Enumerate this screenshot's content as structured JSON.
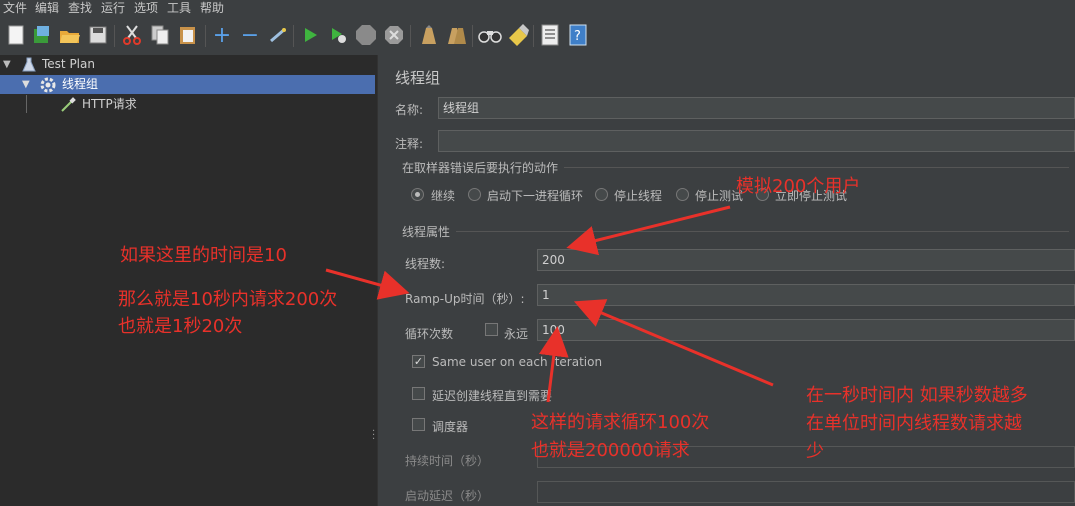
{
  "menu": [
    "文件",
    "编辑",
    "查找",
    "运行",
    "选项",
    "工具",
    "帮助"
  ],
  "tree": {
    "plan_label": "Test Plan",
    "group_label": "线程组",
    "sampler_label": "HTTP请求"
  },
  "panel": {
    "title": "线程组",
    "name_label": "名称:",
    "name_value": "线程组",
    "comment_label": "注释:",
    "comment_value": "",
    "error_action_title": "在取样器错误后要执行的动作",
    "error_actions": [
      "继续",
      "启动下一进程循环",
      "停止线程",
      "停止测试",
      "立即停止测试"
    ],
    "error_action_selected": "继续",
    "thread_props_title": "线程属性",
    "threads_label": "线程数:",
    "threads_value": "200",
    "rampup_label": "Ramp-Up时间（秒）:",
    "rampup_value": "1",
    "loop_label": "循环次数",
    "forever_label": "永远",
    "forever_checked": false,
    "loop_value": "100",
    "same_user_label": "Same user on each iteration",
    "same_user_checked": true,
    "delay_label": "延迟创建线程直到需要",
    "delay_checked": false,
    "scheduler_label": "调度器",
    "scheduler_checked": false,
    "duration_label": "持续时间（秒）",
    "startup_delay_label": "启动延迟（秒）"
  },
  "annotations": {
    "simulate_users": "模拟200个用户",
    "if_time_is": "如果这里的时间是10",
    "then_requests": "那么就是10秒内请求200次",
    "per_second": "也就是1秒20次",
    "loop_requests": "这样的请求循环100次",
    "total_requests": "也就是200000请求",
    "within_second": "在一秒时间内  如果秒数越多",
    "unit_time": "在单位时间内线程数请求越",
    "less": "少"
  },
  "colors": {
    "annotation": "#e8312a",
    "selection": "#4b6eaf",
    "background": "#3c3f41",
    "tree_background": "#2b2b2b"
  }
}
